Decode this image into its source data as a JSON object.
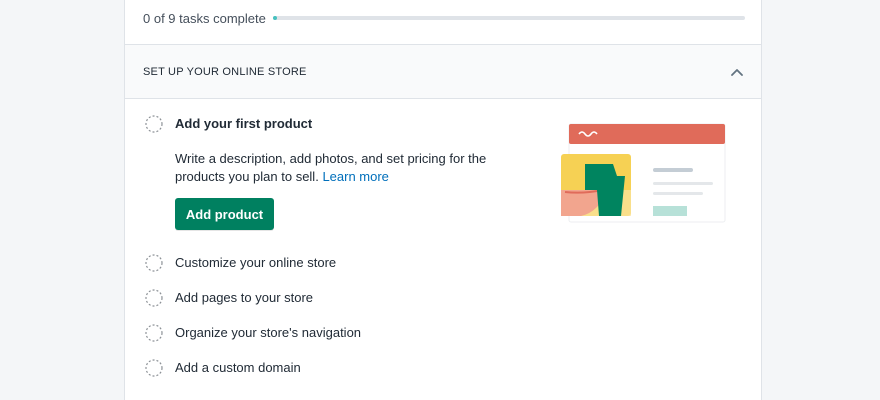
{
  "progress": {
    "text": "0 of 9 tasks complete",
    "completed": 0,
    "total": 9
  },
  "section": {
    "title": "SET UP YOUR ONLINE STORE",
    "collapse_icon": "chevron-up-icon"
  },
  "active_task": {
    "title": "Add your first product",
    "description": "Write a description, add photos, and set pricing for the products you plan to sell.",
    "link": "Learn more",
    "button": "Add product"
  },
  "tasks": [
    {
      "label": "Customize your online store"
    },
    {
      "label": "Add pages to your store"
    },
    {
      "label": "Organize your store's navigation"
    },
    {
      "label": "Add a custom domain"
    }
  ],
  "colors": {
    "primary_button": "#008060",
    "progress_fill": "#47c1bf",
    "link": "#006fbb",
    "illustration_header": "#e06b5a",
    "illustration_yellow": "#f6d154",
    "illustration_green": "#00845f"
  }
}
